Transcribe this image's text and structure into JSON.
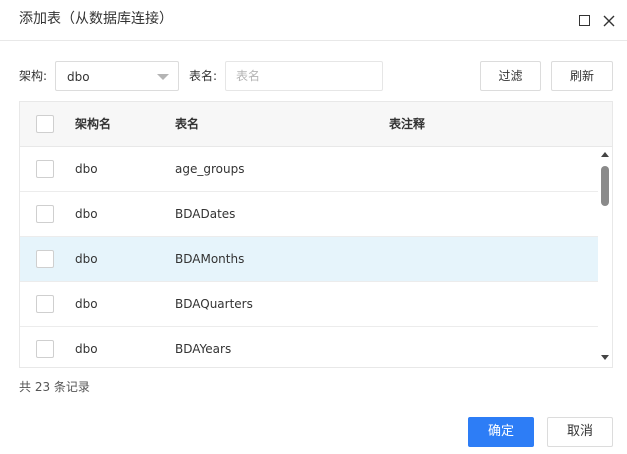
{
  "dialog": {
    "title": "添加表（从数据库连接）",
    "maximize_icon": "maximize-icon",
    "close_icon": "close-icon"
  },
  "filters": {
    "schema_label": "架构:",
    "schema_value": "dbo",
    "table_label": "表名:",
    "table_placeholder": "表名",
    "table_value": "",
    "filter_button": "过滤",
    "refresh_button": "刷新"
  },
  "grid": {
    "columns": [
      "架构名",
      "表名",
      "表注释"
    ],
    "rows": [
      {
        "schema": "dbo",
        "table": "age_groups",
        "comment": "",
        "selected": false,
        "checked": false
      },
      {
        "schema": "dbo",
        "table": "BDADates",
        "comment": "",
        "selected": false,
        "checked": false
      },
      {
        "schema": "dbo",
        "table": "BDAMonths",
        "comment": "",
        "selected": true,
        "checked": false
      },
      {
        "schema": "dbo",
        "table": "BDAQuarters",
        "comment": "",
        "selected": false,
        "checked": false
      },
      {
        "schema": "dbo",
        "table": "BDAYears",
        "comment": "",
        "selected": false,
        "checked": false
      }
    ]
  },
  "footer": {
    "record_count": "共 23 条记录",
    "ok_button": "确定",
    "cancel_button": "取消"
  },
  "colors": {
    "primary": "#2d7df6",
    "selected_row": "#e6f4fb",
    "header_bg": "#f7f7f7"
  }
}
